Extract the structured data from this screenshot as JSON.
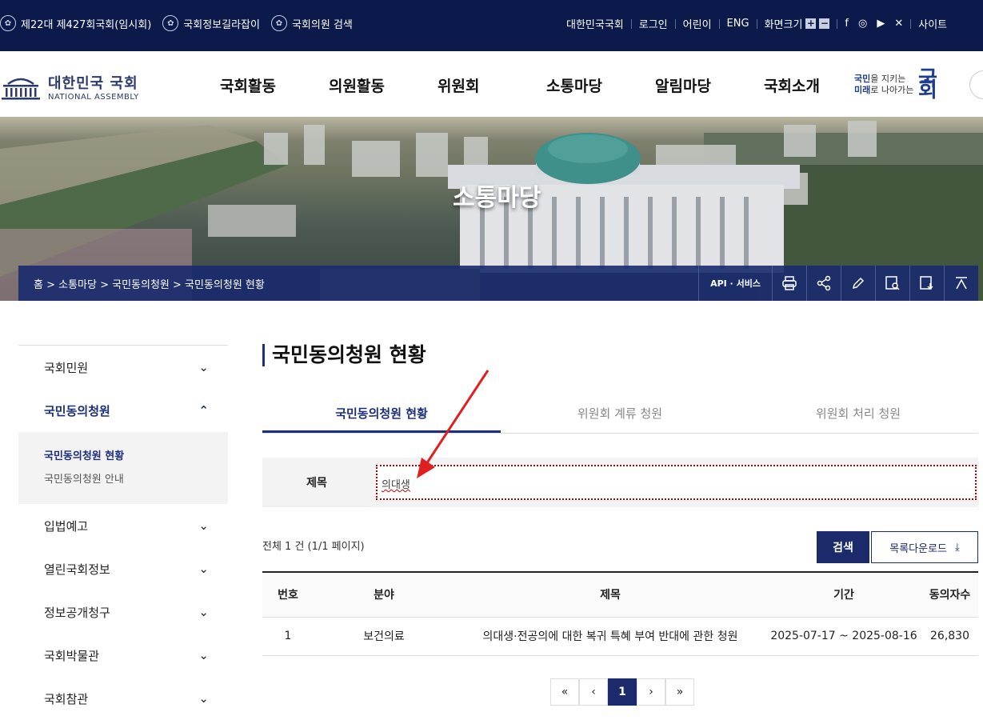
{
  "topbar": {
    "items": [
      "제22대 제427회국회(임시회)",
      "국회정보길라잡이",
      "국회의원 검색"
    ],
    "links": [
      "대한민국국회",
      "로그인",
      "어린이",
      "ENG"
    ],
    "font_size_label": "화면크기",
    "sitemap": "사이트"
  },
  "header": {
    "logo_title": "대한민국 국회",
    "logo_sub": "NATIONAL ASSEMBLY",
    "nav": [
      "국회활동",
      "의원활동",
      "위원회",
      "소통마당",
      "알림마당",
      "국회소개"
    ],
    "slogan_l1_a": "국민",
    "slogan_l1_b": "을 지키는",
    "slogan_l2_a": "미래",
    "slogan_l2_b": "로 나아가는",
    "slogan_big": "국회"
  },
  "hero": {
    "title": "소통마당",
    "breadcrumb": "홈 > 소통마당 > 국민동의청원 > 국민동의청원 현황",
    "api_label": "API · 서비스"
  },
  "sidebar": {
    "items": [
      {
        "label": "국회민원"
      },
      {
        "label": "국민동의청원"
      },
      {
        "label": "입법예고"
      },
      {
        "label": "열린국회정보"
      },
      {
        "label": "정보공개청구"
      },
      {
        "label": "국회박물관"
      },
      {
        "label": "국회참관"
      }
    ],
    "sub": [
      "국민동의청원 현황",
      "국민동의청원 안내"
    ]
  },
  "main": {
    "title": "국민동의청원 현황",
    "tabs": [
      "국민동의청원 현황",
      "위원회 계류 청원",
      "위원회 처리 청원"
    ],
    "search_label": "제목",
    "search_value": "의대생",
    "count_text": "전체 1 건 (1/1 페이지)",
    "search_btn": "검색",
    "download_btn": "목록다운로드",
    "columns": [
      "번호",
      "분야",
      "제목",
      "기간",
      "동의자수"
    ],
    "rows": [
      [
        "1",
        "보건의료",
        "의대생·전공의에 대한 복귀 특혜 부여 반대에 관한 청원",
        "2025-07-17 ~ 2025-08-16",
        "26,830"
      ]
    ],
    "pager": [
      "«",
      "‹",
      "1",
      "›",
      "»"
    ]
  }
}
